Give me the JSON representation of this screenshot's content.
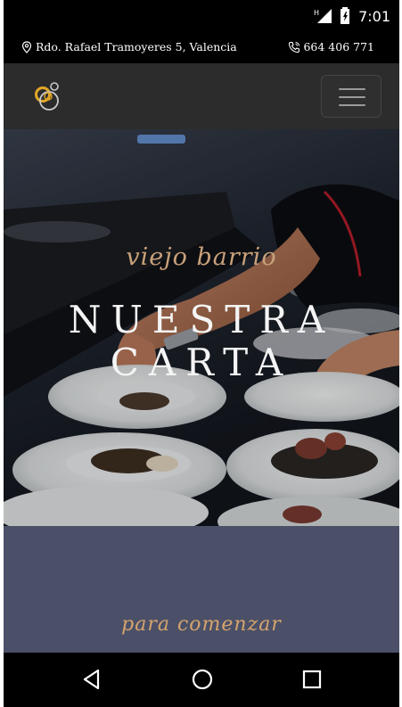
{
  "status": {
    "time": "7:01",
    "network": "H"
  },
  "info": {
    "address": "Rdo. Rafael Tramoyeres 5, Valencia",
    "phone": "664 406 771"
  },
  "nav": {
    "logo": "restaurant-rings-logo"
  },
  "hero": {
    "subtitle": "viejo barrio",
    "title_line1": "NUESTRA",
    "title_line2": "CARTA"
  },
  "section": {
    "subtitle": "para comenzar"
  },
  "colors": {
    "accent_gold": "#c8a17a",
    "section_bg": "#4b5068",
    "nav_bg": "#2c2c2c"
  }
}
